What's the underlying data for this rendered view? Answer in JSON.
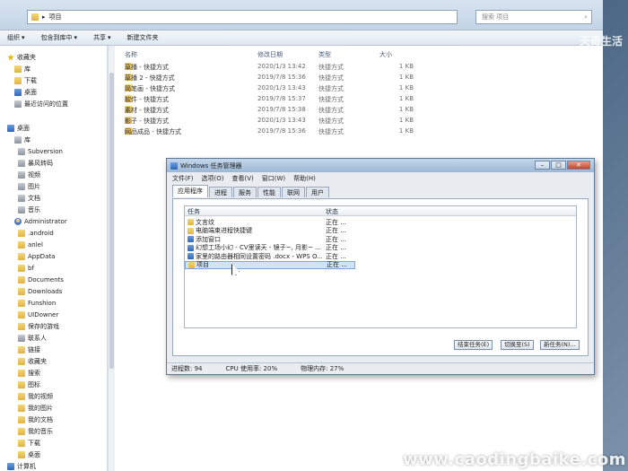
{
  "explorer": {
    "address_path": "项目",
    "search_placeholder": "搜索 项目",
    "toolbar": [
      "组织",
      "包含到库中",
      "共享",
      "新建文件夹"
    ],
    "columns": {
      "name": "名称",
      "date": "修改日期",
      "type": "类型",
      "size": "大小"
    },
    "files": [
      {
        "name": "草播 - 快捷方式",
        "date": "2020/1/3 13:42",
        "type": "快捷方式",
        "size": "1 KB"
      },
      {
        "name": "草播 2 - 快捷方式",
        "date": "2019/7/8 15:36",
        "type": "快捷方式",
        "size": "1 KB"
      },
      {
        "name": "简笔画 - 快捷方式",
        "date": "2020/1/3 13:43",
        "type": "快捷方式",
        "size": "1 KB"
      },
      {
        "name": "软件 - 快捷方式",
        "date": "2019/7/8 15:37",
        "type": "快捷方式",
        "size": "1 KB"
      },
      {
        "name": "素材 - 快捷方式",
        "date": "2019/7/8 15:38",
        "type": "快捷方式",
        "size": "1 KB"
      },
      {
        "name": "影子 - 快捷方式",
        "date": "2020/1/3 13:43",
        "type": "快捷方式",
        "size": "1 KB"
      },
      {
        "name": "网品成品 - 快捷方式",
        "date": "2019/7/8 15:36",
        "type": "快捷方式",
        "size": "1 KB"
      }
    ]
  },
  "nav": {
    "items": [
      {
        "label": "收藏夹",
        "icon": "star-icon"
      },
      {
        "label": "库",
        "icon": "folder-icon"
      },
      {
        "label": "下载",
        "icon": "folder-icon"
      },
      {
        "label": "桌面",
        "icon": "desktop-icon"
      },
      {
        "label": "最近访问的位置",
        "icon": "recent-icon"
      },
      {
        "label": "桌面",
        "icon": "desktop-icon"
      },
      {
        "label": "库",
        "icon": "library-icon"
      },
      {
        "label": "Subversion",
        "icon": "library-icon"
      },
      {
        "label": "暴风转码",
        "icon": "library-icon"
      },
      {
        "label": "视频",
        "icon": "video-icon"
      },
      {
        "label": "图片",
        "icon": "picture-icon"
      },
      {
        "label": "文档",
        "icon": "document-icon"
      },
      {
        "label": "音乐",
        "icon": "music-icon"
      },
      {
        "label": "Administrator",
        "icon": "user-icon"
      },
      {
        "label": ".android",
        "icon": "folder-icon"
      },
      {
        "label": "anlel",
        "icon": "folder-icon"
      },
      {
        "label": "AppData",
        "icon": "folder-icon"
      },
      {
        "label": "bf",
        "icon": "folder-icon"
      },
      {
        "label": "Documents",
        "icon": "folder-icon"
      },
      {
        "label": "Downloads",
        "icon": "folder-icon"
      },
      {
        "label": "Funshion",
        "icon": "folder-icon"
      },
      {
        "label": "UIDowner",
        "icon": "folder-icon"
      },
      {
        "label": "保存的游戏",
        "icon": "folder-icon"
      },
      {
        "label": "联系人",
        "icon": "contacts-icon"
      },
      {
        "label": "链接",
        "icon": "folder-icon"
      },
      {
        "label": "收藏夹",
        "icon": "folder-icon"
      },
      {
        "label": "搜索",
        "icon": "folder-icon"
      },
      {
        "label": "图标",
        "icon": "folder-icon"
      },
      {
        "label": "我的视频",
        "icon": "folder-icon"
      },
      {
        "label": "我的图片",
        "icon": "folder-icon"
      },
      {
        "label": "我的文档",
        "icon": "folder-icon"
      },
      {
        "label": "我的音乐",
        "icon": "folder-icon"
      },
      {
        "label": "下载",
        "icon": "folder-icon"
      },
      {
        "label": "桌面",
        "icon": "folder-icon"
      },
      {
        "label": "计算机",
        "icon": "computer-icon"
      }
    ]
  },
  "taskmgr": {
    "title": "Windows 任务管理器",
    "menu": [
      "文件(F)",
      "选项(O)",
      "查看(V)",
      "窗口(W)",
      "帮助(H)"
    ],
    "tabs": [
      "应用程序",
      "进程",
      "服务",
      "性能",
      "联网",
      "用户"
    ],
    "list_header": {
      "task": "任务",
      "status": "状态"
    },
    "tasks": [
      {
        "name": "文言纹",
        "status": "正在 ..."
      },
      {
        "name": "电脑端束进程快捷键",
        "status": "正在 ..."
      },
      {
        "name": "添加窗口",
        "status": "正在 ..."
      },
      {
        "name": "幻想工场小幻 - CV里读天 - 镜子~, 月影~ ...",
        "status": "正在 ..."
      },
      {
        "name": "家里的路由器相同设置密码 .docx - WPS O...",
        "status": "正在 ..."
      },
      {
        "name": "项目",
        "status": "正在 ..."
      }
    ],
    "buttons": {
      "end_task": "结束任务(E)",
      "switch_to": "切换至(S)",
      "new_task": "新任务(N)..."
    },
    "status": {
      "processes": "进程数: 94",
      "cpu": "CPU 使用率: 20%",
      "memory": "物理内存: 27%"
    }
  },
  "watermark": {
    "top": "天奇生活",
    "bottom": "www.caodingbaike.com"
  }
}
